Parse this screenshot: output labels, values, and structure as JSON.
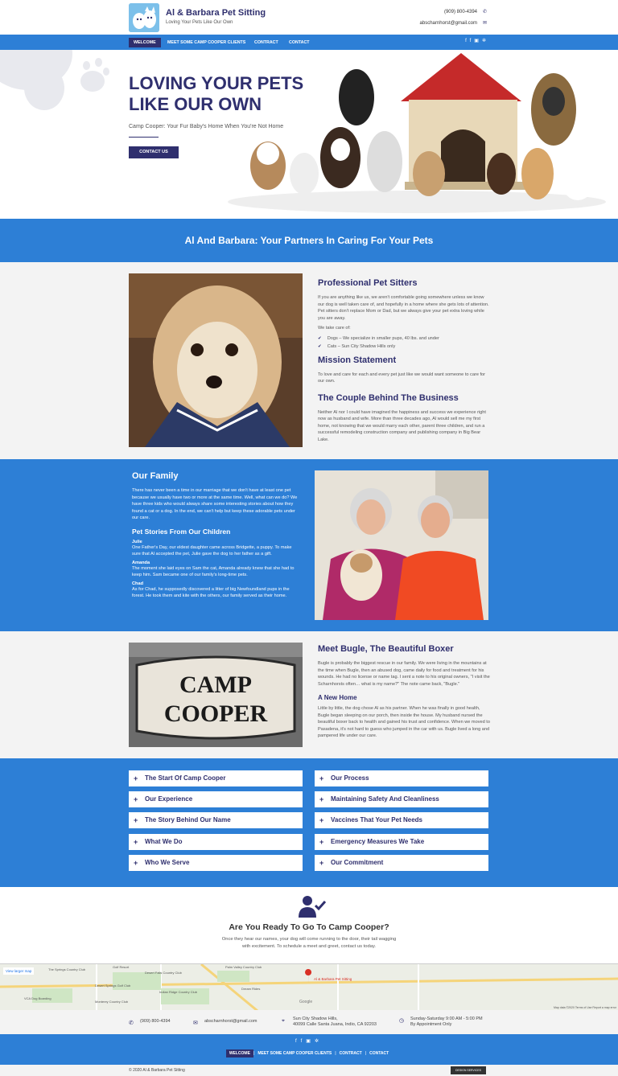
{
  "header": {
    "brand": "Al & Barbara Pet Sitting",
    "tagline": "Loving Your Pets Like Our Own",
    "phone": "(909) 800-4394",
    "email": "abscharnhorst@gmail.com"
  },
  "nav": {
    "items": [
      "WELCOME",
      "MEET SOME CAMP COOPER CLIENTS",
      "CONTRACT",
      "CONTACT"
    ]
  },
  "hero": {
    "title": "LOVING YOUR PETS LIKE OUR OWN",
    "subtitle": "Camp Cooper: Your Fur Baby's Home When You're Not Home",
    "button": "CONTACT US"
  },
  "banner": {
    "title": "Al And Barbara: Your Partners In Caring For Your Pets"
  },
  "about": {
    "h1": "Professional Pet Sitters",
    "p1": "If you are anything like us, we aren't comfortable going somewhere unless we know our dog is well taken care of, and hopefully in a home where she gets lots of attention. Pet sitters don't replace Mom or Dad, but we always give your pet extra loving while you are away.",
    "take": "We take care of:",
    "list": [
      "Dogs – We specialize in smaller pups, 40 lbs. and under",
      "Cats – Sun City Shadow Hills only"
    ],
    "h2": "Mission Statement",
    "p2": "To love and care for each and every pet just like we would want someone to care for our own.",
    "h3": "The Couple Behind The Business",
    "p3": "Neither Al nor I could have imagined the happiness and success we experience right now as husband and wife. More than three decades ago, Al would sell me my first home, not knowing that we would marry each other, parent three children, and run a successful remodeling construction company and publishing company in Big Bear Lake."
  },
  "family": {
    "title": "Our Family",
    "p": "There has never been a time in our marriage that we don't have at least one pet because we usually have two or more at the same time. Well, what can we do? We have three kids who would always share some interesting stories about how they found a cat or a dog. In the end, we can't help but keep these adorable pets under our care.",
    "stories_title": "Pet Stories From Our Children",
    "stories": [
      {
        "name": "Julie",
        "text": "One Father's Day, our eldest daughter came across Bridgette, a puppy. To make sure that Al accepted the pet, Julie gave the dog to her father as a gift."
      },
      {
        "name": "Amanda",
        "text": "The moment she laid eyes on Sam the cat, Amanda already knew that she had to keep him. Sam became one of our family's long-time pets."
      },
      {
        "name": "Chad",
        "text": "As for Chad, he supposedly discovered a litter of big Newfoundland pups in the forest. He took them and kite with the others, our family served as their home."
      }
    ]
  },
  "bugle": {
    "sign": "CAMP COOPER",
    "title": "Meet Bugle, The Beautiful Boxer",
    "p1": "Bugle is probably the biggest rescue in our family. We were living in the mountains at the time when Bugle, then an abused dog, came daily for food and treatment for his wounds. He had no license or name tag. I sent a note to his original owners, \"I visit the Scharnhorsts often… what is my name?\" The note came back, \"Bugle.\"",
    "h2": "A New Home",
    "p2": "Little by little, the dog chose Al as his partner. When he was finally in good health, Bugle began sleeping on our porch, then inside the house. My husband nursed the beautiful boxer back to health and gained his trust and confidence. When we moved to Pasadena, it's not hard to guess who jumped in the car with us. Bugle lived a long and pampered life under our care."
  },
  "accordion": {
    "left": [
      "The Start Of Camp Cooper",
      "Our Experience",
      "The Story Behind Our Name",
      "What We Do",
      "Who We Serve"
    ],
    "right": [
      "Our Process",
      "Maintaining Safety And Cleanliness",
      "Vaccines That Your Pet Needs",
      "Emergency Measures We Take",
      "Our Commitment"
    ]
  },
  "cta": {
    "title": "Are You Ready To Go To Camp Cooper?",
    "text": "Once they hear our names, your dog will come running to the door, their tail wagging with excitement. To schedule a meet and greet, contact us today."
  },
  "map": {
    "larger": "View larger map",
    "pin": "Al & Barbara Pet Sitting",
    "labels": [
      "Golf Resort",
      "The Springs Country Club",
      "Palm Valley Country Club",
      "Desert Falls Country Club",
      "Indian Ridge Country Club",
      "Desert Springs Golf Club",
      "Monterey Country Club",
      "VCA Dog Boarding",
      "Dream Rides"
    ],
    "attr": "Map data ©2020   Terms of Use   Report a map error",
    "google": "Google"
  },
  "contact": {
    "phone": "(909) 800-4394",
    "email": "abscharnhorst@gmail.com",
    "address1": "Sun City Shadow Hills,",
    "address2": "40099 Calle Santa Juana, Indio, CA 92203",
    "hours1": "Sunday-Saturday 9:00 AM - 5:00 PM",
    "hours2": "By Appointment Only"
  },
  "footer": {
    "nav": [
      "WELCOME",
      "MEET SOME CAMP COOPER CLIENTS",
      "CONTRACT",
      "CONTACT"
    ],
    "copyright": "© 2020 Al & Barbara Pet Sitting",
    "badge": "DESIGN SERVICES"
  },
  "colors": {
    "accent": "#2d7fd6",
    "navy": "#2f2f6e"
  }
}
